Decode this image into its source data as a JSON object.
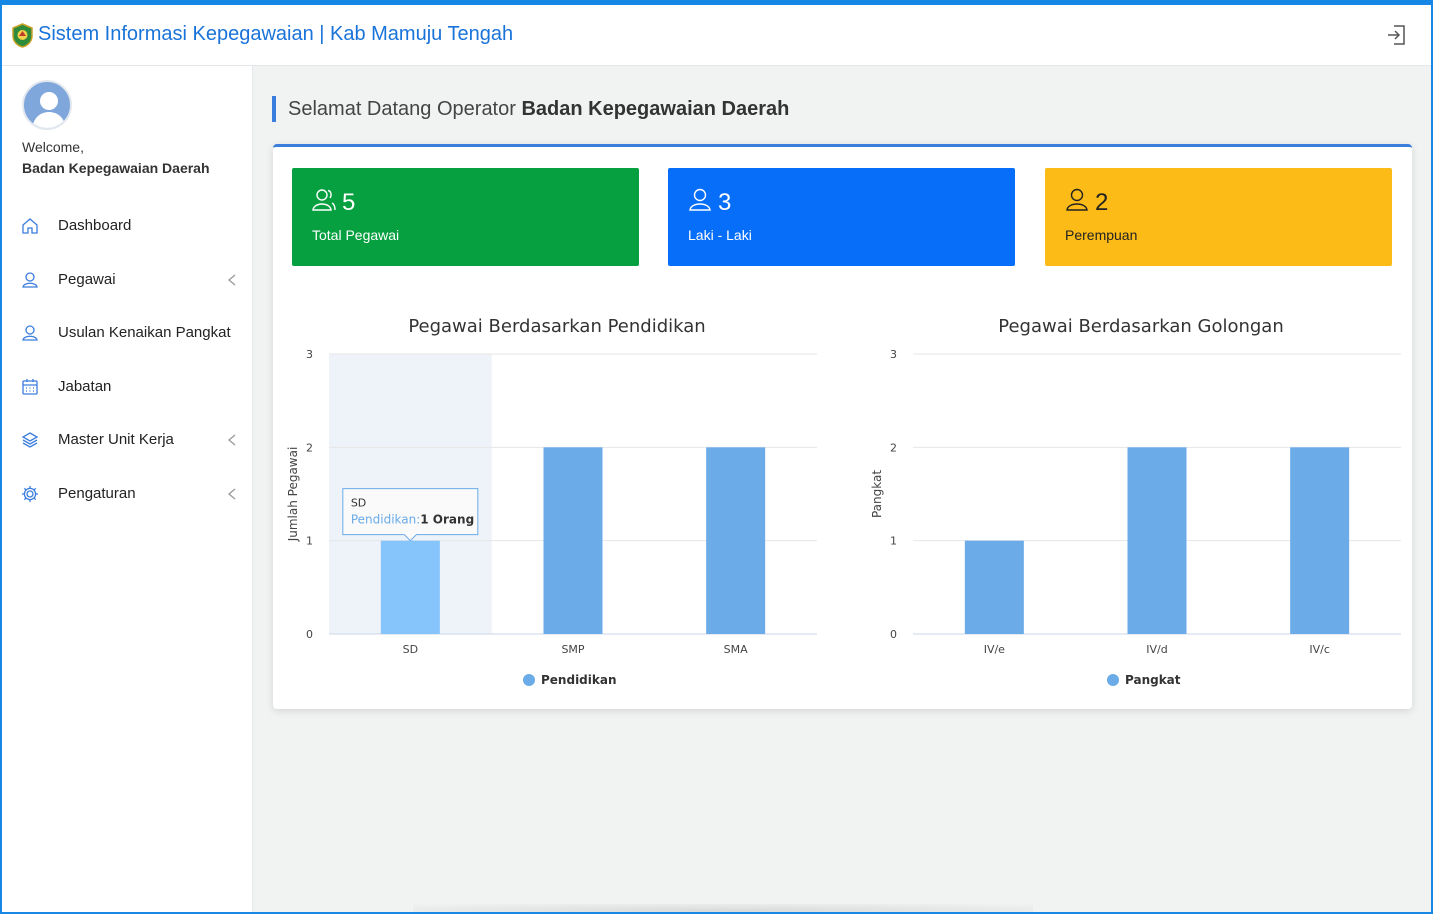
{
  "header": {
    "title": "Sistem Informasi Kepegawaian | Kab Mamuju Tengah"
  },
  "sidebar": {
    "welcome": "Welcome,",
    "user_name": "Badan Kepegawaian Daerah",
    "items": [
      {
        "label": "Dashboard",
        "icon": "home-icon",
        "has_submenu": false
      },
      {
        "label": "Pegawai",
        "icon": "user-icon",
        "has_submenu": true
      },
      {
        "label": "Usulan Kenaikan Pangkat",
        "icon": "user-icon",
        "has_submenu": false
      },
      {
        "label": "Jabatan",
        "icon": "calendar-icon",
        "has_submenu": false
      },
      {
        "label": "Master Unit Kerja",
        "icon": "layers-icon",
        "has_submenu": true
      },
      {
        "label": "Pengaturan",
        "icon": "gear-icon",
        "has_submenu": true
      }
    ]
  },
  "main": {
    "welcome_prefix": "Selamat Datang Operator",
    "welcome_name": "Badan Kepegawaian Daerah",
    "stats": [
      {
        "value": "5",
        "label": "Total Pegawai",
        "color": "#07a040"
      },
      {
        "value": "3",
        "label": "Laki - Laki",
        "color": "#066ef9"
      },
      {
        "value": "2",
        "label": "Perempuan",
        "color": "#fdbb17"
      }
    ]
  },
  "colors": {
    "accent": "#3b7ddd",
    "bar": "#6aabe8",
    "bar_hover": "#86c5fb"
  },
  "chart_data": [
    {
      "type": "bar",
      "title": "Pegawai Berdasarkan Pendidikan",
      "ylabel": "Jumlah Pegawai",
      "categories": [
        "SD",
        "SMP",
        "SMA"
      ],
      "series": [
        {
          "name": "Pendidikan",
          "values": [
            1,
            2,
            2
          ]
        }
      ],
      "ylim": [
        0,
        3
      ],
      "yticks": [
        "0",
        "1",
        "2",
        "3"
      ],
      "grid": true,
      "legend": "bottom",
      "tooltip": {
        "category": "SD",
        "series_label": "Pendidikan:",
        "value_text": "1 Orang"
      }
    },
    {
      "type": "bar",
      "title": "Pegawai Berdasarkan Golongan",
      "ylabel": "Pangkat",
      "categories": [
        "IV/e",
        "IV/d",
        "IV/c"
      ],
      "series": [
        {
          "name": "Pangkat",
          "values": [
            1,
            2,
            2
          ]
        }
      ],
      "ylim": [
        0,
        3
      ],
      "yticks": [
        "0",
        "1",
        "2",
        "3"
      ],
      "grid": true,
      "legend": "bottom"
    }
  ]
}
